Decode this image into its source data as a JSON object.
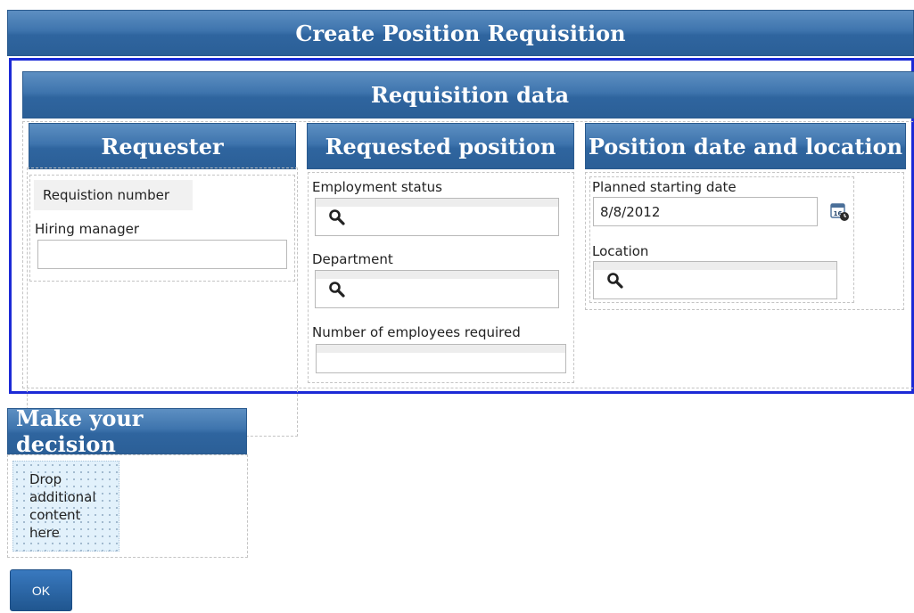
{
  "page_title": "Create Position Requisition",
  "section": {
    "title": "Requisition data",
    "columns": [
      {
        "title": "Requester",
        "requisition_number_label": "Requistion number",
        "hiring_manager_label": "Hiring manager",
        "hiring_manager_value": ""
      },
      {
        "title": "Requested position",
        "employment_status_label": "Employment status",
        "department_label": "Department",
        "employees_required_label": "Number of employees required",
        "employees_required_value": ""
      },
      {
        "title": "Position date and location",
        "start_date_label": "Planned starting date",
        "start_date_value": "8/8/2012",
        "location_label": "Location",
        "calendar_icon_text": "16"
      }
    ]
  },
  "decision": {
    "title": "Make your decision",
    "dropzone_text": "Drop additional content here"
  },
  "actions": {
    "ok_label": "OK"
  },
  "icons": {
    "search": "search-icon",
    "calendar": "calendar-clock-icon"
  },
  "colors": {
    "header_blue": "#2f659f",
    "panel_border": "#1c2ad6",
    "dropzone_bg": "#e2f1fb"
  }
}
